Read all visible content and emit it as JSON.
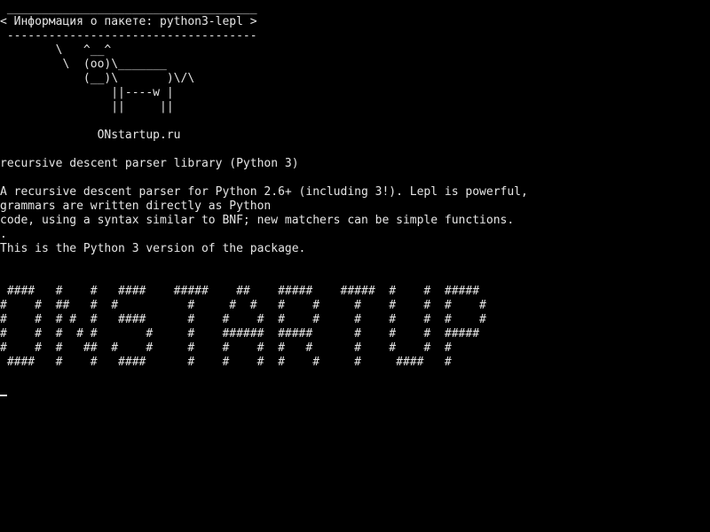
{
  "terminal": {
    "cow": {
      "top_border": " ____________________________________",
      "message": "< Информация о пакете: python3-lepl >",
      "bottom_border": " ------------------------------------",
      "art_1": "        \\   ^__^",
      "art_2": "         \\  (oo)\\_______",
      "art_3": "            (__)\\       )\\/\\",
      "art_4": "                ||----w |",
      "art_5": "                ||     ||",
      "site": "              ONstartup.ru"
    },
    "package": {
      "summary": "recursive descent parser library (Python 3)",
      "description_1": "A recursive descent parser for Python 2.6+ (including 3!). Lepl is powerful,",
      "description_2": "grammars are written directly as Python",
      "description_3": "code, using a syntax similar to BNF; new matchers can be simple functions.",
      "description_4": ".",
      "description_5": "This is the Python 3 version of the package."
    },
    "banner": {
      "row_1": " ####   #    #   ####    #####    ##    #####    #####  #    #  #####",
      "row_2": "#    #  ##   #  #          #     #  #   #    #     #    #    #  #    #",
      "row_3": "#    #  # #  #   ####      #    #    #  #    #     #    #    #  #    #",
      "row_4": "#    #  #  # #       #     #    ######  #####      #    #    #  #####",
      "row_5": "#    #  #   ##  #    #     #    #    #  #   #      #    #    #  #",
      "row_6": " ####   #    #   ####      #    #    #  #    #     #     ####   #"
    },
    "text_color": "#e6e6e6",
    "background_color": "#000000"
  }
}
